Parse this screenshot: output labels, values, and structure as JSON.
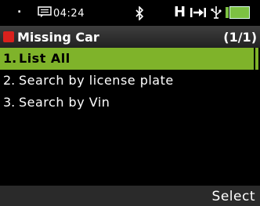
{
  "status": {
    "dot": ".",
    "time": "04:24",
    "network_letter": "H",
    "battery_color": "#7cc142"
  },
  "title": {
    "text": "Missing Car",
    "count": "(1/1)",
    "icon_color": "#d9211d"
  },
  "menu": {
    "items": [
      {
        "num": "1.",
        "label": "List All",
        "selected": true
      },
      {
        "num": "2.",
        "label": "Search by license plate",
        "selected": false
      },
      {
        "num": "3.",
        "label": "Search by Vin",
        "selected": false
      }
    ],
    "selected_color": "#7fb32a"
  },
  "softkeys": {
    "right": "Select"
  }
}
